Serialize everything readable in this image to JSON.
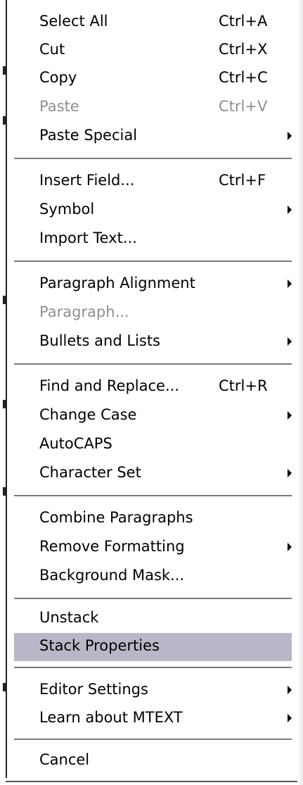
{
  "menu": {
    "items": [
      {
        "label": "Select All",
        "shortcut": "Ctrl+A"
      },
      {
        "label": "Cut",
        "shortcut": "Ctrl+X"
      },
      {
        "label": "Copy",
        "shortcut": "Ctrl+C"
      },
      {
        "label": "Paste",
        "shortcut": "Ctrl+V",
        "enabled": false
      },
      {
        "label": "Paste Special",
        "submenu": true
      },
      {
        "label": "Insert Field...",
        "shortcut": "Ctrl+F"
      },
      {
        "label": "Symbol",
        "submenu": true
      },
      {
        "label": "Import Text..."
      },
      {
        "label": "Paragraph Alignment",
        "submenu": true
      },
      {
        "label": "Paragraph...",
        "enabled": false
      },
      {
        "label": "Bullets and Lists",
        "submenu": true
      },
      {
        "label": "Find and Replace...",
        "shortcut": "Ctrl+R"
      },
      {
        "label": "Change Case",
        "submenu": true
      },
      {
        "label": "AutoCAPS"
      },
      {
        "label": "Character Set",
        "submenu": true
      },
      {
        "label": "Combine Paragraphs"
      },
      {
        "label": "Remove Formatting",
        "submenu": true
      },
      {
        "label": "Background Mask..."
      },
      {
        "label": "Unstack"
      },
      {
        "label": "Stack Properties",
        "selected": true
      },
      {
        "label": "Editor Settings",
        "submenu": true
      },
      {
        "label": "Learn about MTEXT",
        "submenu": true
      },
      {
        "label": "Cancel"
      }
    ]
  },
  "colors": {
    "selected_background": "#b9b7c7",
    "disabled_text": "#8f8f8f",
    "separator": "#7a7a7a"
  }
}
